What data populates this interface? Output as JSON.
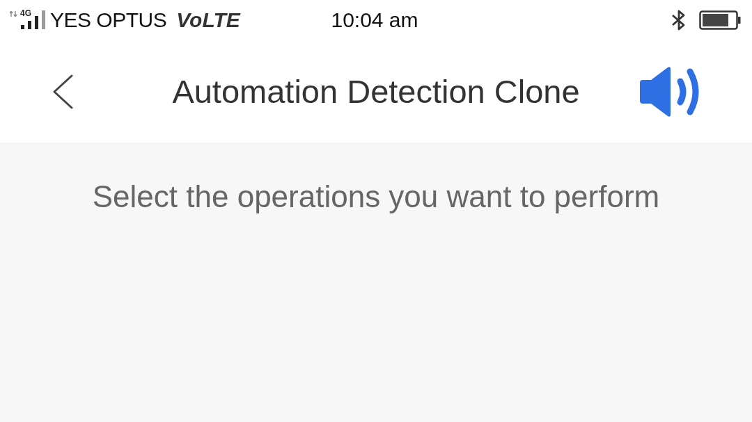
{
  "status_bar": {
    "network": "4G",
    "carrier": "YES OPTUS",
    "volte": "VoLTE",
    "time": "10:04 am"
  },
  "nav_bar": {
    "title": "Automation Detection Clone"
  },
  "content": {
    "instruction": "Select the operations you want to perform"
  }
}
